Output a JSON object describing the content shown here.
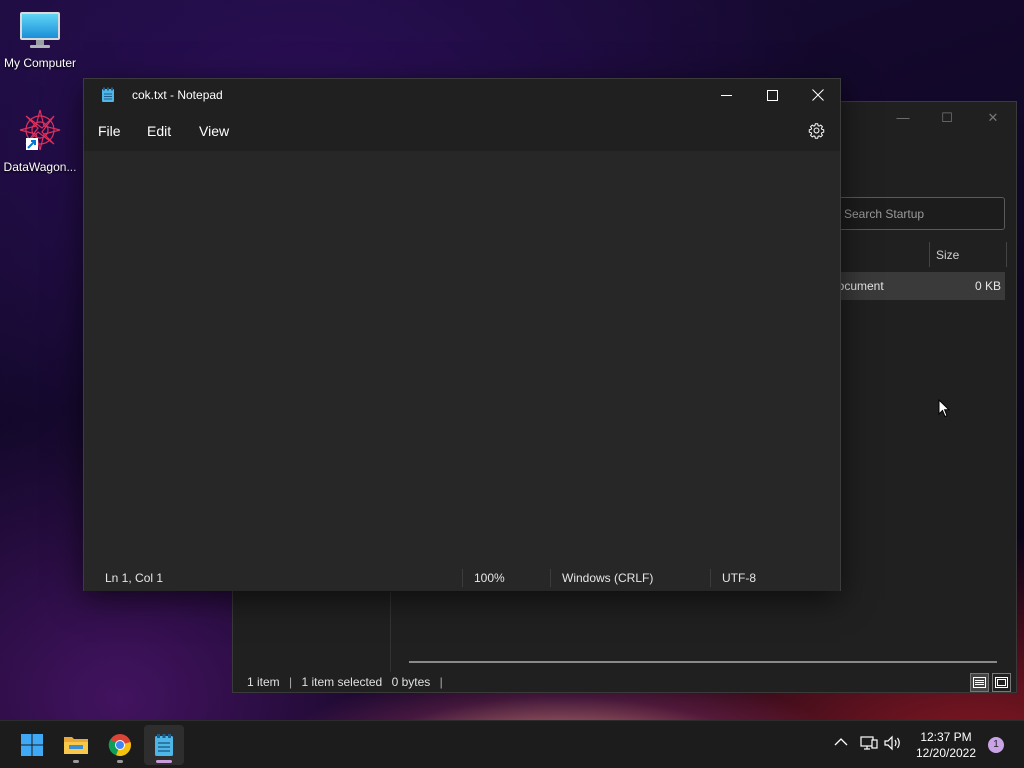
{
  "desktop": {
    "icons": [
      {
        "label": "My Computer",
        "icon": "monitor-icon"
      },
      {
        "label": "DataWagon...",
        "icon": "datawagon-app-icon"
      }
    ]
  },
  "explorer": {
    "search_placeholder": "Search Startup",
    "columns": {
      "size": "Size"
    },
    "row": {
      "type": "Document",
      "size": "0 KB"
    },
    "status": {
      "items": "1 item",
      "separator": "|",
      "selected": "1 item selected",
      "bytes": "0 bytes"
    }
  },
  "notepad": {
    "title": "cok.txt - Notepad",
    "menu": {
      "file": "File",
      "edit": "Edit",
      "view": "View"
    },
    "content": "",
    "status": {
      "position": "Ln 1, Col 1",
      "zoom": "100%",
      "line_ending": "Windows (CRLF)",
      "encoding": "UTF-8"
    }
  },
  "taskbar": {
    "apps": [
      "start-icon",
      "file-explorer-icon",
      "chrome-icon",
      "notepad-icon"
    ],
    "time": "12:37 PM",
    "date": "12/20/2022",
    "notifications": "1"
  },
  "colors": {
    "window_bg": "#272727",
    "titlebar_bg": "#202020",
    "taskbar_bg": "#1c1c1c",
    "accent": "#0078d4"
  }
}
